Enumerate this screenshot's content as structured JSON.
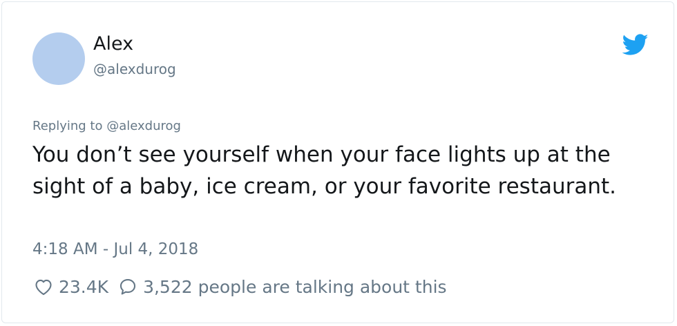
{
  "tweet": {
    "author_name": "Alex",
    "author_handle": "@alexdurog",
    "replying_to": "Replying to @alexdurog",
    "text": "You don’t see yourself when your face lights up at the sight of a baby, ice cream, or your favorite restaurant.",
    "timestamp": "4:18 AM - Jul 4, 2018",
    "like_count": "23.4K",
    "talking_count": "3,522",
    "talking_label": "people are talking about this"
  },
  "icons": {
    "brand": "twitter-bird-icon",
    "like": "heart-icon",
    "reply": "speech-bubble-icon"
  },
  "colors": {
    "brand_blue": "#1da1f2",
    "secondary_text": "#657786",
    "primary_text": "#14171a",
    "avatar_placeholder": "#b4cdee"
  }
}
